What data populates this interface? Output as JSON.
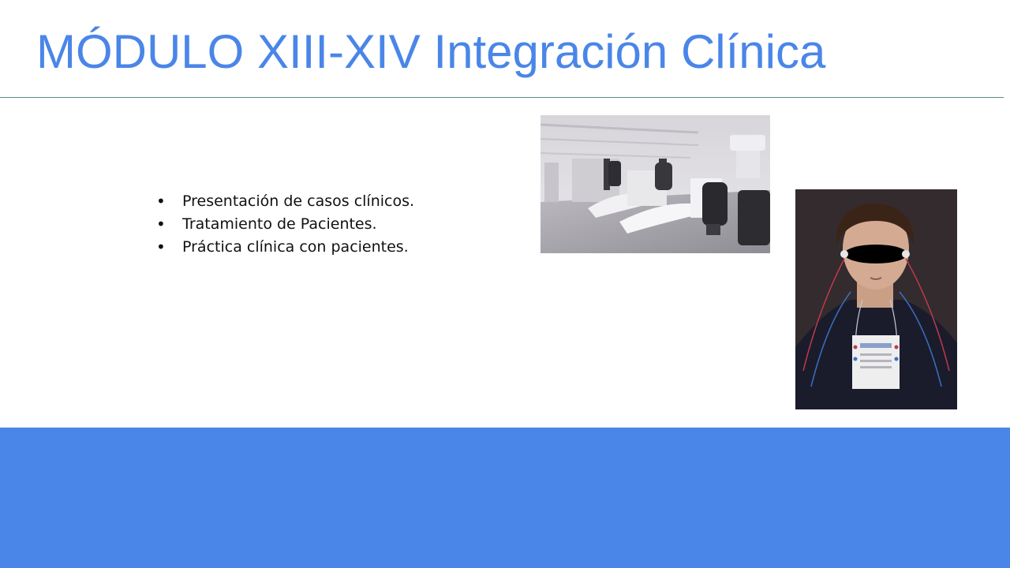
{
  "slide": {
    "title": "MÓDULO XIII-XIV Integración Clínica",
    "bullets": [
      "Presentación de casos clínicos.",
      "Tratamiento de Pacientes.",
      "Práctica clínica con pacientes."
    ]
  },
  "colors": {
    "title": "#4a86e8",
    "rule": "#5b8a8a",
    "footer_band": "#4a86e8"
  },
  "images": {
    "clinic_photo": "dental-clinic-photo",
    "patient_photo": "patient-electromyography-photo"
  }
}
